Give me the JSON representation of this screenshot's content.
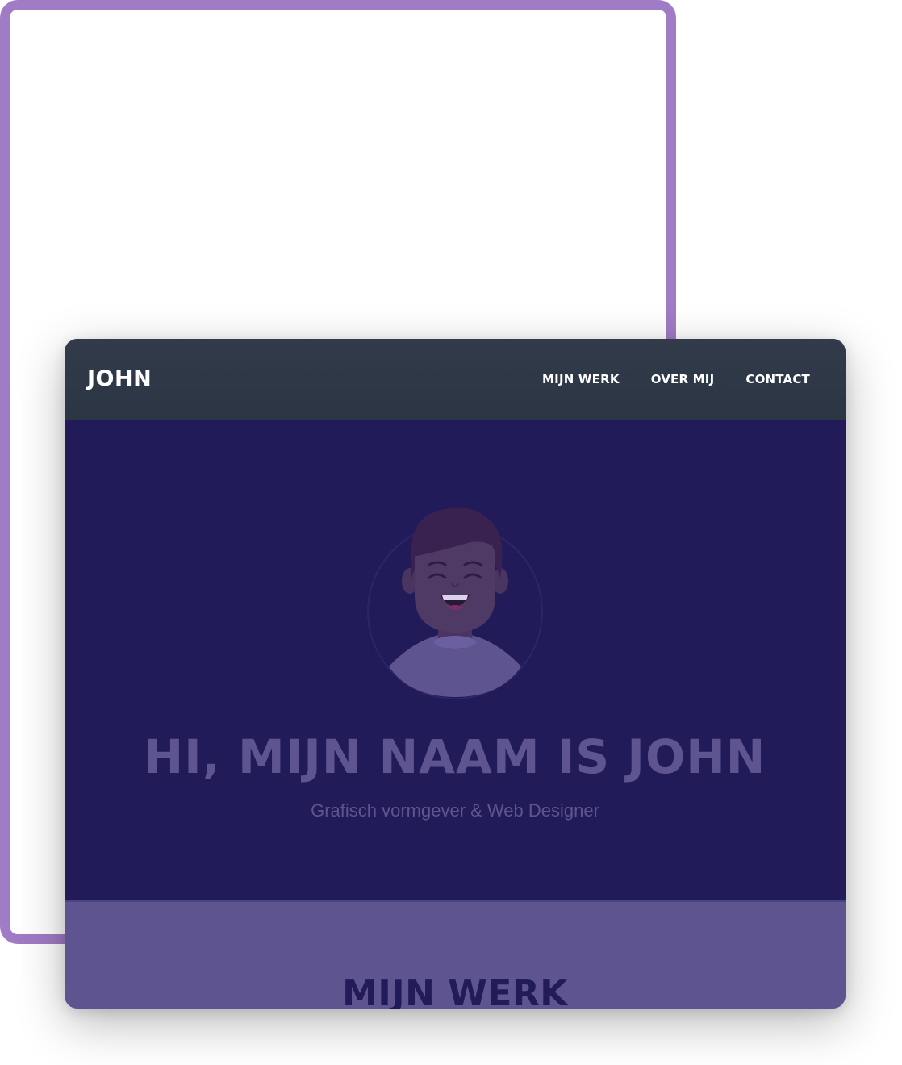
{
  "nav": {
    "brand": "JOHN",
    "links": [
      {
        "label": "MIJN WERK"
      },
      {
        "label": "OVER MIJ"
      },
      {
        "label": "CONTACT"
      }
    ]
  },
  "hero": {
    "avatar_icon": "smiling-man-avatar-icon",
    "title": "HI, MIJN NAAM IS JOHN",
    "subtitle": "Grafisch vormgever & Web Designer"
  },
  "work": {
    "title": "MIJN WERK"
  },
  "colors": {
    "frame_outline": "#a07bc6",
    "navbar": "#2e3846",
    "hero_background": "#221b59",
    "hero_text": "#5e5590",
    "section_background": "#5e5590",
    "section_title": "#221b59",
    "nav_text": "#ffffff"
  }
}
